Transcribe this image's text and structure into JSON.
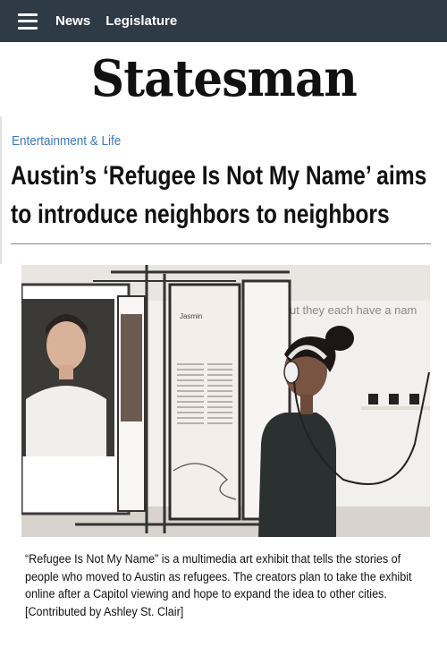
{
  "nav": {
    "items": [
      "News",
      "Legislature"
    ]
  },
  "masthead": {
    "logo_text": "Statesman"
  },
  "article": {
    "section": "Entertainment & Life",
    "headline_line1": "Austin’s ‘Refugee Is Not My Name’ aims",
    "headline_line2": "to introduce neighbors to neighbors",
    "photo": {
      "panel_name": "Jasmin",
      "wall_text": "ut they each have a nam"
    },
    "caption": "“Refugee Is Not My Name” is a multimedia art exhibit that tells the stories of people who moved to Austin as refugees. The creators plan to take the exhibit online after a Capitol viewing and hope to expand the idea to other cities. [Contributed by Ashley St. Clair]"
  },
  "colors": {
    "topbar": "#2f3a47",
    "section": "#3a7bbf",
    "text": "#111111"
  }
}
